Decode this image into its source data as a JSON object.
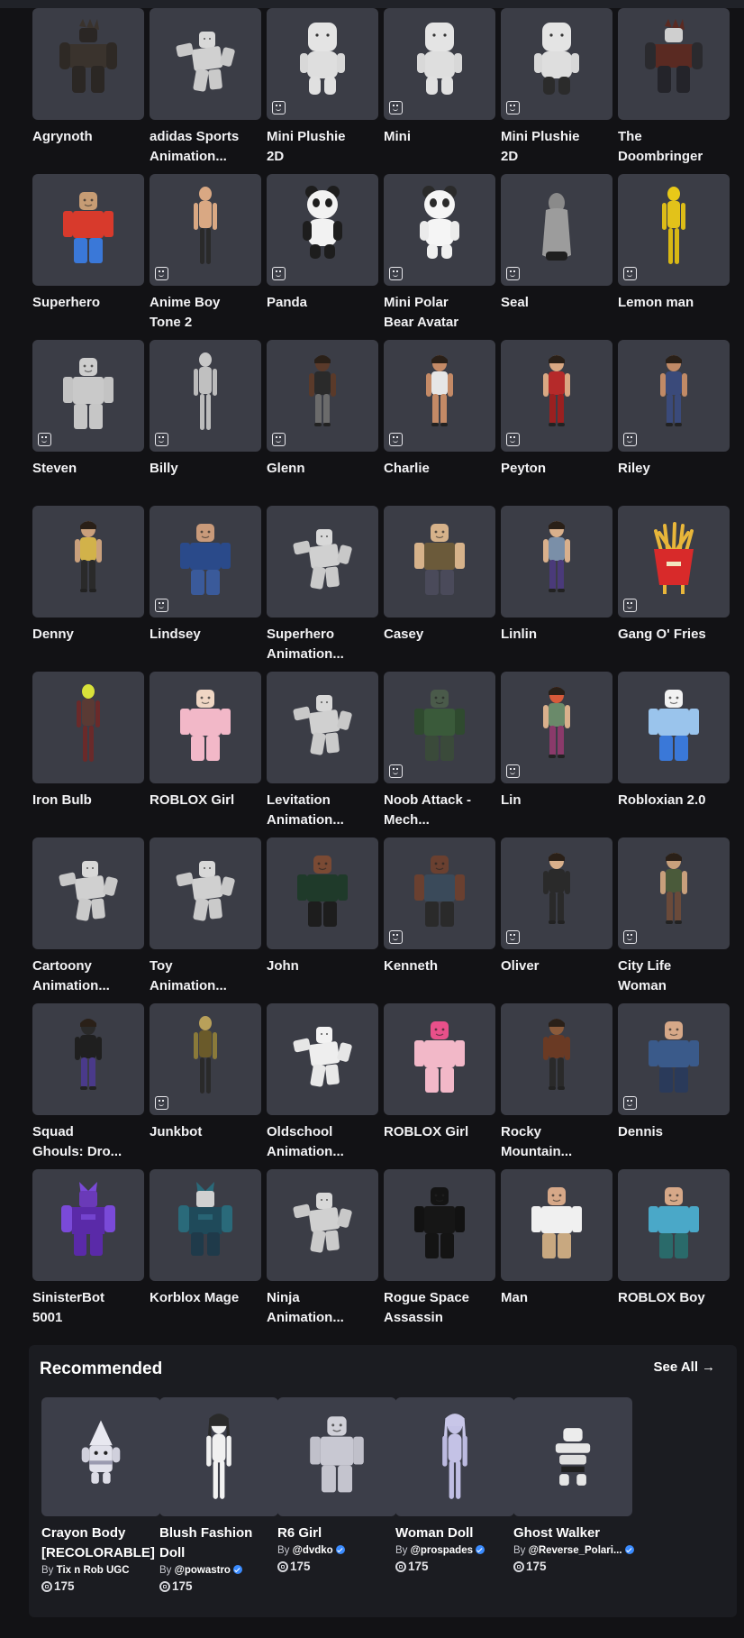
{
  "catalog": {
    "items": [
      {
        "name": "Agrynoth",
        "kind": "dark-creature",
        "badge": false,
        "colors": {
          "head": "#2a2624",
          "torso": "#3a332d",
          "arms": "#2e2925",
          "legs": "#2b2724"
        }
      },
      {
        "name": "adidas Sports\nAnimation...",
        "kind": "animation",
        "badge": false,
        "colors": {
          "head": "#d8d8d8",
          "torso": "#d0d0d0",
          "arms": "#c8c8c8",
          "legs": "#cacaca"
        }
      },
      {
        "name": "Mini Plushie\n2D",
        "kind": "mini",
        "badge": true,
        "colors": {
          "head": "#e4e4e4",
          "torso": "#dedede",
          "arms": "#d8d8d8",
          "legs": "#e0e0e0"
        }
      },
      {
        "name": "Mini",
        "kind": "mini",
        "badge": true,
        "colors": {
          "head": "#e4e4e4",
          "torso": "#dedede",
          "arms": "#d8d8d8",
          "legs": "#e0e0e0"
        }
      },
      {
        "name": "Mini Plushie\n2D",
        "kind": "mini",
        "badge": true,
        "colors": {
          "head": "#e4e4e4",
          "torso": "#dedede",
          "arms": "#d8d8d8",
          "legs": "#2b2b2b"
        }
      },
      {
        "name": "The\nDoombringer",
        "kind": "dark-creature",
        "badge": false,
        "colors": {
          "head": "#cfcfcf",
          "torso": "#5a2a22",
          "arms": "#2a2a2e",
          "legs": "#24242a"
        }
      },
      {
        "name": "Superhero",
        "kind": "classic",
        "badge": false,
        "colors": {
          "head": "#c69c74",
          "torso": "#d83a2c",
          "arms": "#d83a2c",
          "legs": "#3a78d8"
        }
      },
      {
        "name": "Anime Boy\nTone 2",
        "kind": "slim",
        "badge": true,
        "colors": {
          "head": "#d9a883",
          "torso": "#d9a883",
          "arms": "#d9a883",
          "legs": "#2a2a2a"
        }
      },
      {
        "name": "Panda",
        "kind": "bear",
        "badge": true,
        "colors": {
          "head": "#f2f2f2",
          "torso": "#1d1d1d",
          "arms": "#1d1d1d",
          "legs": "#1d1d1d"
        }
      },
      {
        "name": "Mini Polar\nBear Avatar",
        "kind": "bear",
        "badge": true,
        "colors": {
          "head": "#f5f5f5",
          "torso": "#f0f0f0",
          "arms": "#ebebeb",
          "legs": "#2a2a2a"
        }
      },
      {
        "name": "Seal",
        "kind": "seal",
        "badge": true,
        "colors": {
          "head": "#8a8a8a",
          "torso": "#9c9c9c",
          "arms": "#7c7c7c",
          "legs": "#1f1f1f"
        }
      },
      {
        "name": "Lemon man",
        "kind": "slim",
        "badge": true,
        "colors": {
          "head": "#e8c918",
          "torso": "#e2c21a",
          "arms": "#dcbc18",
          "legs": "#d8b814"
        }
      },
      {
        "name": "Steven",
        "kind": "classic",
        "badge": true,
        "colors": {
          "head": "#cdcdcd",
          "torso": "#c9c9c9",
          "arms": "#c3c3c3",
          "legs": "#c6c6c6"
        }
      },
      {
        "name": "Billy",
        "kind": "slim",
        "badge": true,
        "colors": {
          "head": "#c7c7c7",
          "torso": "#c0c0c0",
          "arms": "#bbbbbb",
          "legs": "#bcbcbc"
        }
      },
      {
        "name": "Glenn",
        "kind": "person",
        "badge": true,
        "colors": {
          "head": "#5a3a2a",
          "torso": "#2a2a2a",
          "arms": "#5a3a2a",
          "legs": "#6b6b6b"
        }
      },
      {
        "name": "Charlie",
        "kind": "person",
        "badge": true,
        "colors": {
          "head": "#c48a66",
          "torso": "#e6e6e6",
          "arms": "#c48a66",
          "legs": "#c48a66"
        }
      },
      {
        "name": "Peyton",
        "kind": "person",
        "badge": true,
        "colors": {
          "head": "#d9a883",
          "torso": "#b52a2a",
          "arms": "#d9a883",
          "legs": "#9a2020"
        }
      },
      {
        "name": "Riley",
        "kind": "person",
        "badge": true,
        "colors": {
          "head": "#c18a66",
          "torso": "#3a4a7a",
          "arms": "#c18a66",
          "legs": "#3a4a7a"
        }
      },
      {
        "name": "Denny",
        "kind": "person",
        "badge": false,
        "colors": {
          "head": "#c9a07c",
          "torso": "#d2b24a",
          "arms": "#c9a07c",
          "legs": "#2a2a2a"
        }
      },
      {
        "name": "Lindsey",
        "kind": "classic",
        "badge": true,
        "colors": {
          "head": "#c99a7a",
          "torso": "#2a4a8a",
          "arms": "#2a4a8a",
          "legs": "#3a5a9a"
        }
      },
      {
        "name": "Superhero\nAnimation...",
        "kind": "animation",
        "badge": false,
        "colors": {
          "head": "#d8d8d8",
          "torso": "#d0d0d0",
          "arms": "#c8c8c8",
          "legs": "#cacaca"
        }
      },
      {
        "name": "Casey",
        "kind": "classic",
        "badge": false,
        "colors": {
          "head": "#d6b28a",
          "torso": "#6b5a3a",
          "arms": "#d6b28a",
          "legs": "#4a4a5a"
        }
      },
      {
        "name": "Linlin",
        "kind": "person",
        "badge": false,
        "colors": {
          "head": "#d9b08c",
          "torso": "#7a8fa8",
          "arms": "#d9b08c",
          "legs": "#4a3a7a"
        }
      },
      {
        "name": "Gang O' Fries",
        "kind": "fries",
        "badge": true,
        "colors": {
          "head": "#e8b63a",
          "torso": "#d82a2a",
          "arms": "#e8b63a",
          "legs": "#d82a2a"
        }
      },
      {
        "name": "Iron Bulb",
        "kind": "slim",
        "badge": false,
        "colors": {
          "head": "#d8e23a",
          "torso": "#5a3a34",
          "arms": "#6a2a2a",
          "legs": "#6a2a2a"
        }
      },
      {
        "name": "ROBLOX Girl",
        "kind": "classic",
        "badge": false,
        "colors": {
          "head": "#efd6c4",
          "torso": "#f2b8c8",
          "arms": "#f2b8c8",
          "legs": "#f2b8c8"
        }
      },
      {
        "name": "Levitation\nAnimation...",
        "kind": "animation",
        "badge": false,
        "colors": {
          "head": "#d8d8d8",
          "torso": "#d0d0d0",
          "arms": "#c8c8c8",
          "legs": "#cacaca"
        }
      },
      {
        "name": "Noob Attack -\nMech...",
        "kind": "classic",
        "badge": true,
        "colors": {
          "head": "#4a5a4a",
          "torso": "#3a5a3a",
          "arms": "#2f4a2f",
          "legs": "#3a4a3a"
        }
      },
      {
        "name": "Lin",
        "kind": "person",
        "badge": true,
        "colors": {
          "head": "#d85a3a",
          "torso": "#6a8a6a",
          "arms": "#d9b08c",
          "legs": "#8a3a6a"
        }
      },
      {
        "name": "Robloxian 2.0",
        "kind": "classic",
        "badge": false,
        "colors": {
          "head": "#f2f2f2",
          "torso": "#9ac4ec",
          "arms": "#9ac4ec",
          "legs": "#3a78d8"
        }
      },
      {
        "name": "Cartoony\nAnimation...",
        "kind": "animation",
        "badge": false,
        "colors": {
          "head": "#d8d8d8",
          "torso": "#d0d0d0",
          "arms": "#c8c8c8",
          "legs": "#cacaca"
        }
      },
      {
        "name": "Toy\nAnimation...",
        "kind": "animation",
        "badge": false,
        "colors": {
          "head": "#d8d8d8",
          "torso": "#d0d0d0",
          "arms": "#c8c8c8",
          "legs": "#cacaca"
        }
      },
      {
        "name": "John",
        "kind": "classic",
        "badge": false,
        "colors": {
          "head": "#7a4a34",
          "torso": "#1f3a2a",
          "arms": "#1f3a2a",
          "legs": "#1d1d1d"
        }
      },
      {
        "name": "Kenneth",
        "kind": "classic",
        "badge": true,
        "colors": {
          "head": "#6a4030",
          "torso": "#3a4a5a",
          "arms": "#6a4030",
          "legs": "#2a2a2a"
        }
      },
      {
        "name": "Oliver",
        "kind": "person",
        "badge": true,
        "colors": {
          "head": "#d9b08c",
          "torso": "#2a2a2a",
          "arms": "#2a2a2a",
          "legs": "#2a2a2a"
        }
      },
      {
        "name": "City Life\nWoman",
        "kind": "person",
        "badge": true,
        "colors": {
          "head": "#c8a07c",
          "torso": "#4a5a3a",
          "arms": "#c8a07c",
          "legs": "#6a4a3a"
        }
      },
      {
        "name": "Squad\nGhouls: Dro...",
        "kind": "person",
        "badge": false,
        "colors": {
          "head": "#2a2a2a",
          "torso": "#1f1f1f",
          "arms": "#1f1f1f",
          "legs": "#4a3a8a"
        }
      },
      {
        "name": "Junkbot",
        "kind": "slim",
        "badge": true,
        "colors": {
          "head": "#b8a05a",
          "torso": "#6a5a2a",
          "arms": "#8a7a3a",
          "legs": "#2a2a2a"
        }
      },
      {
        "name": "Oldschool\nAnimation...",
        "kind": "animation",
        "badge": false,
        "colors": {
          "head": "#f2f2f2",
          "torso": "#eeeeee",
          "arms": "#e6e6e6",
          "legs": "#e8e8e8"
        }
      },
      {
        "name": "ROBLOX Girl",
        "kind": "classic",
        "badge": false,
        "colors": {
          "head": "#e8508a",
          "torso": "#f2b8c8",
          "arms": "#f2b8c8",
          "legs": "#f2b8c8"
        }
      },
      {
        "name": "Rocky\nMountain...",
        "kind": "person",
        "badge": false,
        "colors": {
          "head": "#8a5a3a",
          "torso": "#6a3a24",
          "arms": "#6a3a24",
          "legs": "#2a2a2a"
        }
      },
      {
        "name": "Dennis",
        "kind": "classic",
        "badge": true,
        "colors": {
          "head": "#d6a888",
          "torso": "#3a5a8a",
          "arms": "#3a5a8a",
          "legs": "#2a3a5a"
        }
      },
      {
        "name": "SinisterBot\n5001",
        "kind": "robot",
        "badge": false,
        "colors": {
          "head": "#6a3ab8",
          "torso": "#5a2aa8",
          "arms": "#7a4ad8",
          "legs": "#5a2aa8"
        }
      },
      {
        "name": "Korblox Mage",
        "kind": "robot",
        "badge": false,
        "colors": {
          "head": "#d0d0d0",
          "torso": "#1f4a5a",
          "arms": "#2a6a7a",
          "legs": "#1f3a4a"
        }
      },
      {
        "name": "Ninja\nAnimation...",
        "kind": "animation",
        "badge": false,
        "colors": {
          "head": "#d8d8d8",
          "torso": "#d0d0d0",
          "arms": "#c8c8c8",
          "legs": "#cacaca"
        }
      },
      {
        "name": "Rogue Space\nAssassin",
        "kind": "classic",
        "badge": false,
        "colors": {
          "head": "#141414",
          "torso": "#161616",
          "arms": "#121212",
          "legs": "#141414"
        }
      },
      {
        "name": "Man",
        "kind": "classic",
        "badge": false,
        "colors": {
          "head": "#d6a888",
          "torso": "#f0f0f0",
          "arms": "#f0f0f0",
          "legs": "#c8a880"
        }
      },
      {
        "name": "ROBLOX Boy",
        "kind": "classic",
        "badge": false,
        "colors": {
          "head": "#d6a888",
          "torso": "#4aa8c8",
          "arms": "#4aa8c8",
          "legs": "#2a6a6a"
        }
      }
    ]
  },
  "recommended": {
    "title": "Recommended",
    "see_all": "See All",
    "by_label": "By",
    "items": [
      {
        "name": "Crayon Body\n[RECOLORABLE]",
        "creator": "Tix n Rob UGC",
        "verified": false,
        "price": "175",
        "kind": "crayon",
        "colors": {
          "head": "#e8e8f0",
          "torso": "#e0e0ea",
          "arms": "#d0d0dc",
          "legs": "#dcdce6"
        }
      },
      {
        "name": "Blush Fashion\nDoll",
        "creator": "@powastro",
        "verified": true,
        "price": "175",
        "kind": "doll",
        "colors": {
          "head": "#2a2a2a",
          "torso": "#f0f0f0",
          "arms": "#f0f0f0",
          "legs": "#f2f2f2"
        }
      },
      {
        "name": "R6 Girl",
        "creator": "@dvdko",
        "verified": true,
        "price": "175",
        "kind": "classic",
        "colors": {
          "head": "#d0d0d8",
          "torso": "#c8c8d2",
          "arms": "#c0c0ca",
          "legs": "#c4c4ce"
        }
      },
      {
        "name": "Woman Doll",
        "creator": "@prospades",
        "verified": true,
        "price": "175",
        "kind": "doll",
        "colors": {
          "head": "#c8c6e8",
          "torso": "#c4c2e6",
          "arms": "#bcbae0",
          "legs": "#c0bee4"
        }
      },
      {
        "name": "Ghost Walker",
        "creator": "@Reverse_Polari...",
        "verified": true,
        "price": "175",
        "kind": "ghost",
        "colors": {
          "head": "#ececec",
          "torso": "#e6e6e6",
          "arms": "#dedede",
          "legs": "#1f1f1f"
        }
      }
    ]
  }
}
